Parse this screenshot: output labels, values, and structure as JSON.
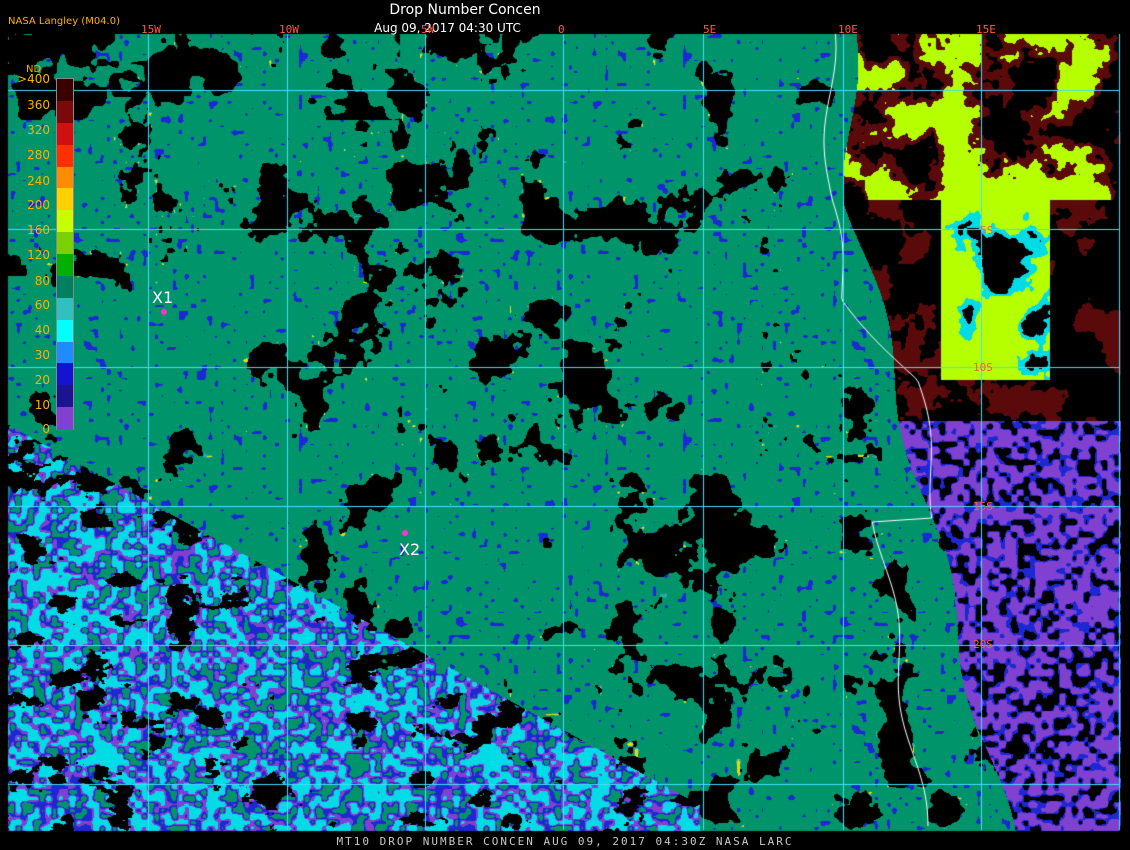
{
  "header": {
    "title": "Drop Number Concen",
    "datetime": "Aug 09, 2017 04:30 UTC",
    "provider": "NASA Langley (M04.0)"
  },
  "grid": {
    "lon_labels": [
      "15W",
      "10W",
      "5W",
      "0",
      "5E",
      "10E",
      "15E"
    ],
    "lat_labels": [
      "5S",
      "10S",
      "15S",
      "20S"
    ],
    "line_color": "#3fdfff",
    "label_color": "#ff5a3c"
  },
  "legend": {
    "unit": "ND",
    "labels": [
      ">400",
      "360",
      "320",
      "280",
      "240",
      "200",
      "160",
      "120",
      "80",
      "60",
      "40",
      "30",
      "20",
      "10",
      "0"
    ],
    "colors": [
      "#3a0000",
      "#7a0a0a",
      "#d01010",
      "#ff3000",
      "#ff8c00",
      "#ffd000",
      "#c8ff00",
      "#7ad000",
      "#00b000",
      "#008060",
      "#30c0c0",
      "#00ffff",
      "#1e8cff",
      "#1414d0",
      "#1a1490",
      "#8040d0"
    ]
  },
  "markers": [
    {
      "label": "X1"
    },
    {
      "label": "X2"
    }
  ],
  "footer": "MT10  DROP NUMBER CONCEN   AUG 09, 2017 04:30Z   NASA LARC",
  "palette": {
    "ocean_cloud": "#00946a",
    "clear": "#000000",
    "thin": "#8040d0",
    "highlight": "#b5ff00",
    "coast": "#ffffff"
  }
}
